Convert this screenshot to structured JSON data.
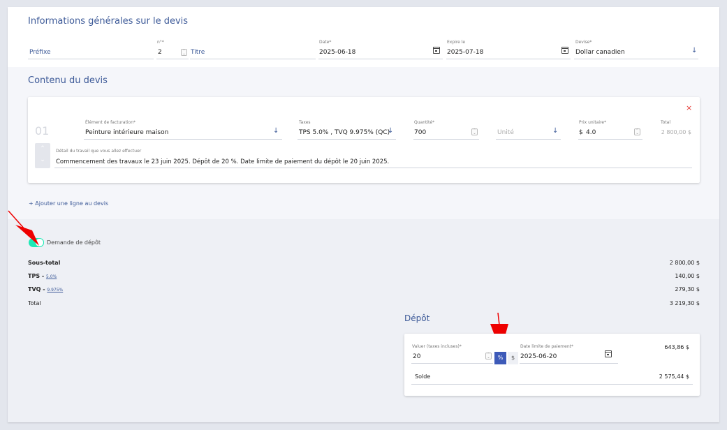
{
  "general": {
    "title": "Informations générales sur le devis",
    "prefix_placeholder": "Préfixe",
    "number_label": "n°*",
    "number_value": "2",
    "title_placeholder": "Titre",
    "date_label": "Date*",
    "date_value": "2025-06-18",
    "expiry_label": "Expire le",
    "expiry_value": "2025-07-18",
    "currency_label": "Devise*",
    "currency_value": "Dollar canadien"
  },
  "content": {
    "title": "Contenu du devis",
    "line": {
      "index": "01",
      "item_label": "Élément de facturation*",
      "item_value": "Peinture intérieure maison",
      "taxes_label": "Taxes",
      "taxes_value": "TPS 5.0% , TVQ 9.975% (QC)",
      "qty_label": "Quantité*",
      "qty_value": "700",
      "unit_placeholder": "Unité",
      "price_label": "Prix unitaire*",
      "price_currency": "$",
      "price_value": "4.0",
      "total_label": "Total",
      "total_value": "2 800,00 $",
      "detail_label": "Détail du travail que vous allez effectuer",
      "detail_value": "Commencement des travaux le 23 juin 2025. Dépôt de 20 %. Date limite de paiement du dépôt le 20 juin 2025.",
      "remove_icon": "×"
    },
    "add_line": "+ Ajouter une ligne au devis"
  },
  "deposit_toggle": {
    "label": "Demande de dépôt",
    "on": true,
    "color": "#1de9b6"
  },
  "totals": {
    "subtotal_label": "Sous-total",
    "subtotal_value": "2 800,00 $",
    "tps_label": "TPS - ",
    "tps_rate": "5.0%",
    "tps_value": "140,00 $",
    "tvq_label": "TVQ - ",
    "tvq_rate": "9.975%",
    "tvq_value": "279,30 $",
    "total_label": "Total",
    "total_value": "3 219,30 $"
  },
  "deposit": {
    "title": "Dépôt",
    "value_label": "Valuer (taxes incluses)*",
    "value": "20",
    "percent_symbol": "%",
    "dollar_symbol": "$",
    "due_label": "Date limite de paiement*",
    "due_value": "2025-06-20",
    "amount": "643,86 $",
    "balance_label": "Solde",
    "balance_value": "2 575,44 $"
  }
}
